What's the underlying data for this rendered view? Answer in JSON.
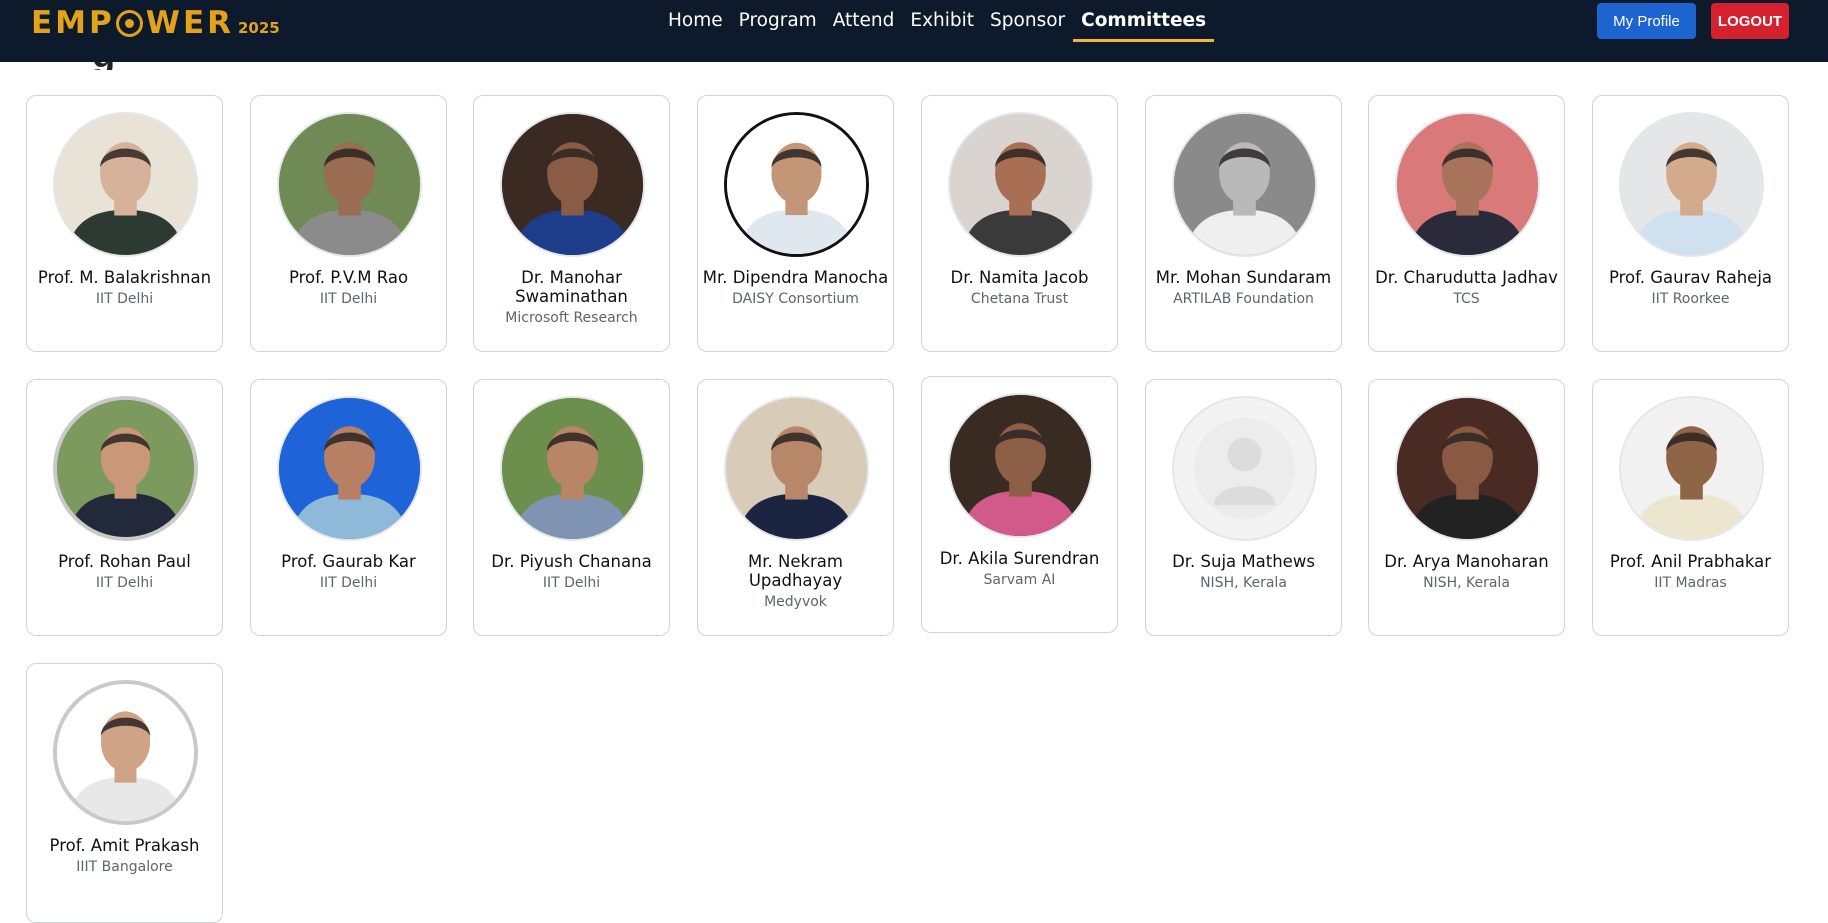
{
  "brand": {
    "name": "EMPOWER",
    "year": "2025",
    "accent_color": "#e3a21c"
  },
  "nav": {
    "items": [
      {
        "label": "Home"
      },
      {
        "label": "Program"
      },
      {
        "label": "Attend"
      },
      {
        "label": "Exhibit"
      },
      {
        "label": "Sponsor"
      },
      {
        "label": "Committees",
        "active": true
      }
    ]
  },
  "header": {
    "profile_label": "My Profile",
    "logout_label": "LOGOUT"
  },
  "page": {
    "heading_fragment": "g"
  },
  "members": [
    {
      "name": "Prof. M. Balakrishnan",
      "affiliation": "IIT Delhi"
    },
    {
      "name": "Prof. P.V.M Rao",
      "affiliation": "IIT Delhi"
    },
    {
      "name": "Dr. Manohar Swaminathan",
      "affiliation": "Microsoft Research"
    },
    {
      "name": "Mr. Dipendra Manocha",
      "affiliation": "DAISY Consortium"
    },
    {
      "name": "Dr. Namita Jacob",
      "affiliation": "Chetana Trust"
    },
    {
      "name": "Mr. Mohan Sundaram",
      "affiliation": "ARTILAB Foundation"
    },
    {
      "name": "Dr. Charudutta Jadhav",
      "affiliation": "TCS"
    },
    {
      "name": "Prof. Gaurav Raheja",
      "affiliation": "IIT Roorkee"
    },
    {
      "name": "Prof. Rohan Paul",
      "affiliation": "IIT Delhi"
    },
    {
      "name": "Prof. Gaurab Kar",
      "affiliation": "IIT Delhi"
    },
    {
      "name": "Dr. Piyush Chanana",
      "affiliation": "IIT Delhi"
    },
    {
      "name": "Mr. Nekram Upadhayay",
      "affiliation": "Medyvok"
    },
    {
      "name": "Dr. Akila Surendran",
      "affiliation": "Sarvam AI"
    },
    {
      "name": "Dr. Suja Mathews",
      "affiliation": "NISH, Kerala"
    },
    {
      "name": "Dr. Arya Manoharan",
      "affiliation": "NISH, Kerala"
    },
    {
      "name": "Prof. Anil Prabhakar",
      "affiliation": "IIT Madras"
    },
    {
      "name": "Prof. Amit Prakash",
      "affiliation": "IIIT Bangalore"
    }
  ]
}
